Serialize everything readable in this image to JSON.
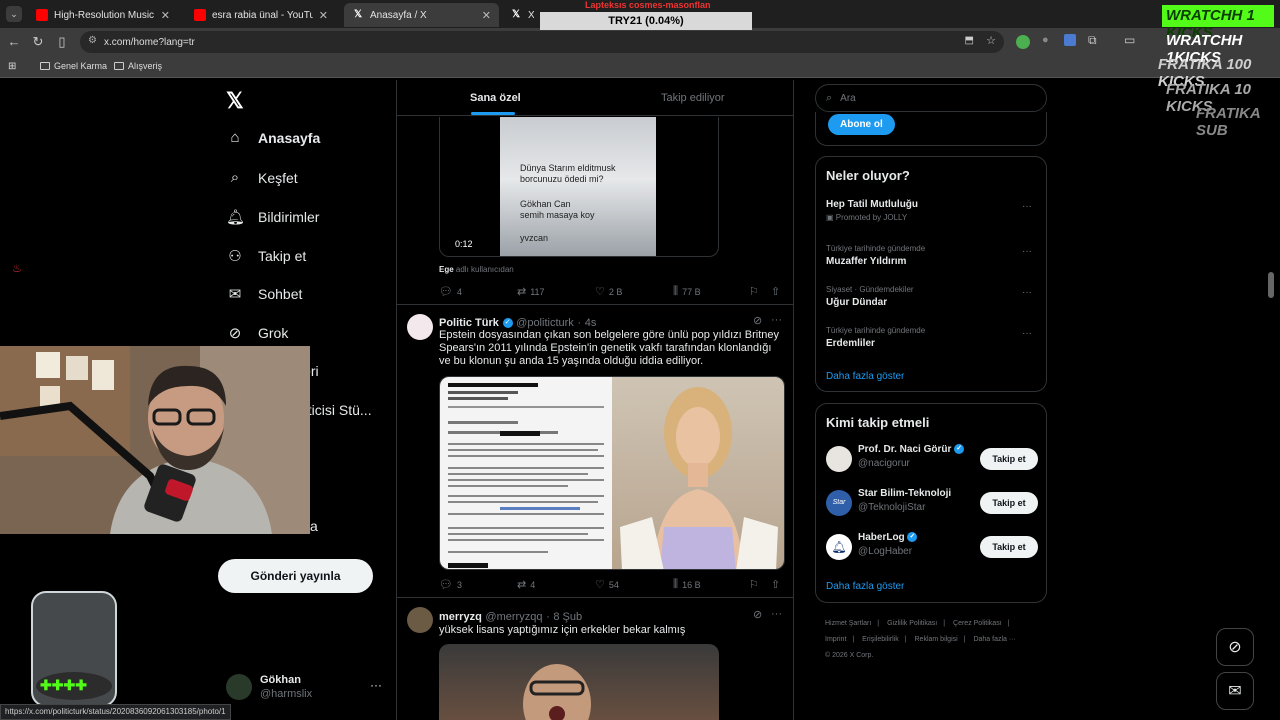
{
  "browser": {
    "tabs": [
      {
        "title": "High-Resolution Music for Audi",
        "active": false
      },
      {
        "title": "esra rabia ünal - YouTube",
        "active": false
      },
      {
        "title": "Anasayfa / X",
        "active": true
      },
      {
        "title": "X'te Te",
        "active": false
      }
    ],
    "url": "x.com/home?lang=tr",
    "bookmarks": [
      "Genel Karma",
      "Alışveriş"
    ],
    "status_url": "https://x.com/politicturk/status/2020836092061303185/photo/1"
  },
  "overlay": {
    "ticker_top": "Lapteksıs cosmes-masonflan",
    "ticker": "TRY21 (0.04%)",
    "kicks": [
      "WRATCHH 1 KICKS",
      "WRATCHH 1KICKS",
      "FRATIKA 100 KICKS",
      "FRATIKA 10 KICKS",
      "FRATIKA SUB"
    ]
  },
  "nav": {
    "items": [
      {
        "label": "Anasayfa",
        "icon": "home-icon"
      },
      {
        "label": "Keşfet",
        "icon": "search-icon"
      },
      {
        "label": "Bildirimler",
        "icon": "bell-icon"
      },
      {
        "label": "Takip et",
        "icon": "add-person-icon"
      },
      {
        "label": "Sohbet",
        "icon": "mail-icon"
      },
      {
        "label": "Grok",
        "icon": "grok-icon"
      },
      {
        "label": "leri",
        "icon": ""
      },
      {
        "label": "eticisi Stü...",
        "icon": ""
      },
      {
        "label": "a",
        "icon": ""
      }
    ],
    "post_button": "Gönderi yayınla",
    "account": {
      "name": "Gökhan",
      "handle": "@harmslix"
    }
  },
  "feed": {
    "tabs": [
      "Sana özel",
      "Takip ediliyor"
    ],
    "post1": {
      "video_time": "0:12",
      "video_overlay_lines": [
        "Dünya Starım elditmusk",
        "borcunuzu ödedi mi?",
        "Gökhan Can",
        "semih masaya koy",
        "yvzcan"
      ],
      "footer_name": "Ege",
      "footer_rest": "adlı kullanıcıdan",
      "replies": "4",
      "reposts": "117",
      "likes": "2 B",
      "views": "77 B"
    },
    "post2": {
      "name": "Politic Türk",
      "handle": "@politicturk",
      "time": "4s",
      "text": "Epstein dosyasından çıkan son belgelere göre ünlü pop yıldızı Britney Spears'ın 2011 yılında Epstein'in genetik vakfı tarafından klonlandığı ve bu klonun şu anda 15 yaşında olduğu iddia ediliyor.",
      "replies": "3",
      "reposts": "4",
      "likes": "54",
      "views": "16 B"
    },
    "post3": {
      "name": "merryzq",
      "handle": "@merryzqq",
      "time": "8 Şub",
      "text": "yüksek lisans yaptığımız için erkekler bekar kalmış"
    }
  },
  "right": {
    "search_placeholder": "Ara",
    "subscribe": "Abone ol",
    "trends_title": "Neler oluyor?",
    "trends": [
      {
        "category": "",
        "name": "Hep Tatil Mutluluğu",
        "note": "Promoted by JOLLY"
      },
      {
        "category": "Türkiye tarihinde gündemde",
        "name": "Muzaffer Yıldırım",
        "note": ""
      },
      {
        "category": "Siyaset · Gündemdekiler",
        "name": "Uğur Dündar",
        "note": ""
      },
      {
        "category": "Türkiye tarihinde gündemde",
        "name": "Erdemliler",
        "note": ""
      }
    ],
    "show_more": "Daha fazla göster",
    "follow_title": "Kimi takip etmeli",
    "follow": [
      {
        "name": "Prof. Dr. Naci Görür",
        "handle": "@nacigorur",
        "button": "Takip et"
      },
      {
        "name": "Star Bilim-Teknoloji",
        "handle": "@TeknolojiStar",
        "button": "Takip et"
      },
      {
        "name": "HaberLog",
        "handle": "@LogHaber",
        "button": "Takip et"
      }
    ],
    "footer": [
      "Hizmet Şartları",
      "Gizlilik Politikası",
      "Çerez Politikası",
      "Imprint",
      "Erişilebilirlik",
      "Reklam bilgisi",
      "Daha fazla ···",
      "© 2026 X Corp."
    ]
  },
  "colors": {
    "accent": "#1d9bf0",
    "kick_green": "#53fc18",
    "border": "#2f3336"
  }
}
